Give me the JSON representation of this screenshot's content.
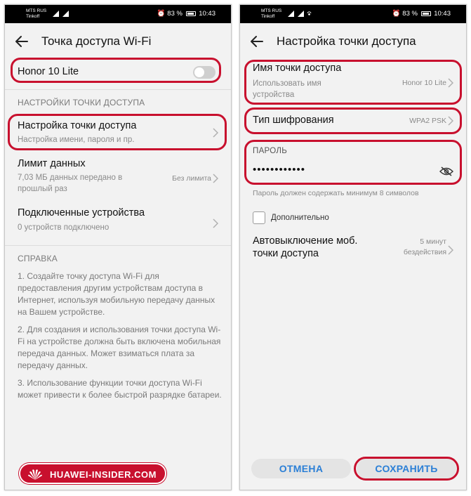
{
  "status_bar": {
    "carrier_primary": "MTS RUS",
    "carrier_secondary": "Tinkoff",
    "battery": "83 %",
    "time": "10:43"
  },
  "left": {
    "title": "Точка доступа Wi-Fi",
    "hotspot_name": "Honor 10 Lite",
    "hotspot_enabled": false,
    "settings_header": "НАСТРОЙКИ ТОЧКИ ДОСТУПА",
    "setup_title": "Настройка точки доступа",
    "setup_sub": "Настройка имени, пароля и пр.",
    "limit_title": "Лимит данных",
    "limit_sub_1": "7,03 МБ данных передано в",
    "limit_sub_2": "прошлый раз",
    "limit_value": "Без лимита",
    "devices_title": "Подключенные устройства",
    "devices_sub": "0 устройств подключено",
    "help_header": "СПРАВКА",
    "help_1": "1. Создайте точку доступа Wi-Fi для предоставления другим устройствам доступа в Интернет, используя мобильную передачу данных на Вашем устройстве.",
    "help_2": "2. Для создания и использования точки доступа Wi-Fi на устройстве должна быть включена мобильная передача данных. Может взиматься плата за передачу данных.",
    "help_3": "3. Использование функции точки доступа Wi-Fi может привести к более быстрой разрядке батареи.",
    "brand": "HUAWEI-INSIDER.COM"
  },
  "right": {
    "title": "Настройка точки доступа",
    "name_title": "Имя точки доступа",
    "name_sub_1": "Использовать имя",
    "name_sub_2": "устройства",
    "name_value": "Honor 10 Lite",
    "enc_title": "Тип шифрования",
    "enc_value": "WPA2 PSK",
    "password_label": "ПАРОЛЬ",
    "password_masked": "••••••••••••",
    "password_hint": "Пароль должен содержать минимум 8 символов",
    "advanced_label": "Дополнительно",
    "advanced_checked": false,
    "auto_off_title_1": "Автовыключение моб.",
    "auto_off_title_2": "точки доступа",
    "auto_off_value_1": "5 минут",
    "auto_off_value_2": "бездействия",
    "cancel_label": "ОТМЕНА",
    "save_label": "СОХРАНИТЬ"
  },
  "colors": {
    "highlight": "#c8102e",
    "accent": "#2b7fd6",
    "background": "#f2f2f2"
  }
}
